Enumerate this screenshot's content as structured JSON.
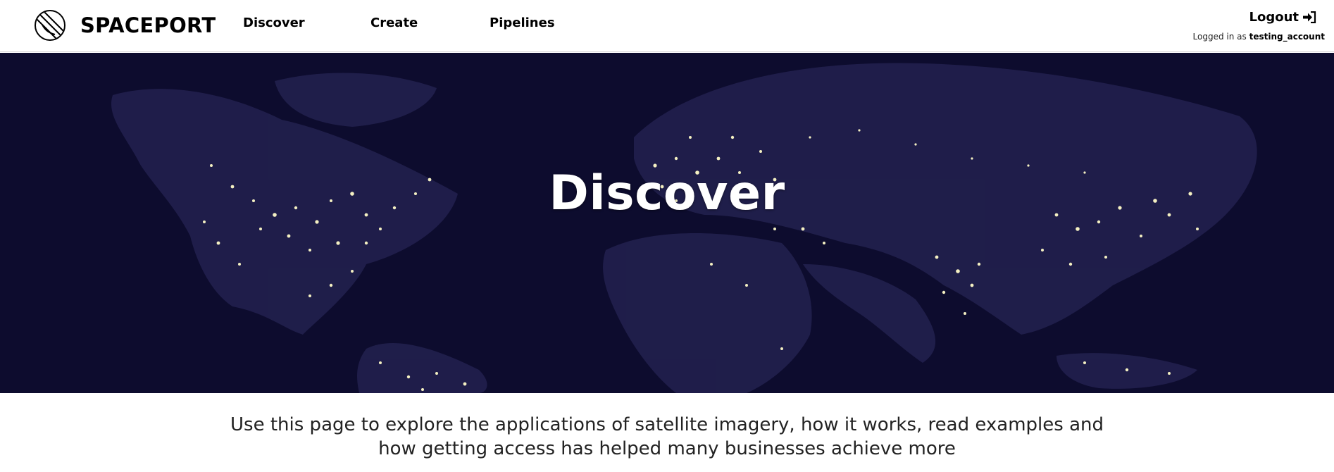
{
  "header": {
    "brand": {
      "name": "SPACEPORT",
      "logo_icon": "planet-logo-icon"
    },
    "nav": [
      {
        "label": "Discover"
      },
      {
        "label": "Create"
      },
      {
        "label": "Pipelines"
      }
    ],
    "account": {
      "logout_label": "Logout",
      "logout_icon": "sign-in-arrow-icon",
      "status_prefix": "Logged in as",
      "username": "testing_account"
    }
  },
  "hero": {
    "title": "Discover",
    "background": "world-at-night-map-image",
    "background_color": "#0d0c2e",
    "land_color": "#232150",
    "city_light_color": "#f4f0c2"
  },
  "intro": {
    "text": "Use this page to explore the applications of satellite imagery, how it works, read examples and how getting access has helped many businesses achieve more"
  }
}
